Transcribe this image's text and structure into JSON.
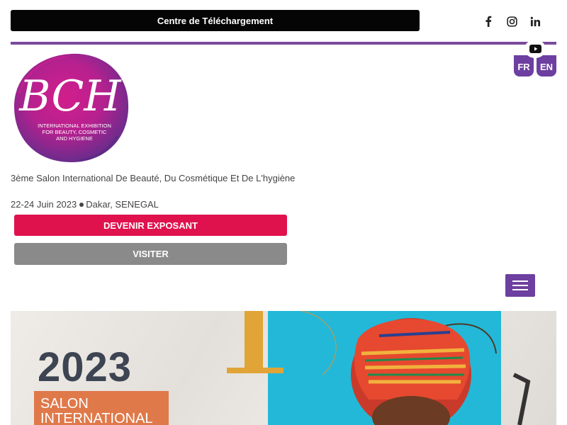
{
  "header": {
    "download_label": "Centre de Téléchargement",
    "social": [
      "facebook-icon",
      "instagram-icon",
      "linkedin-icon",
      "youtube-icon"
    ],
    "languages": [
      "FR",
      "EN"
    ]
  },
  "logo": {
    "letters": "BCH",
    "subtitle_lines": [
      "INTERNATIONAL EXHIBITION",
      "FOR BEAUTY, COSMETIC",
      "AND HYGIENE"
    ]
  },
  "event": {
    "tagline": "3ème Salon International De Beauté, Du Cosmétique Et De L'hygiène",
    "dates": "22-24 Juin 2023",
    "location": "Dakar, SENEGAL"
  },
  "buttons": {
    "exhibit": "DEVENIR EXPOSANT",
    "visit": "VISITER"
  },
  "hero": {
    "year": "2023",
    "headline": [
      "SALON",
      "INTERNATIONAL"
    ]
  },
  "colors": {
    "accent_purple": "#6d3fa0",
    "exhibit_red": "#e0124d",
    "visit_gray": "#8a8a8a",
    "hero_cyan": "#23b8d8",
    "hero_orange": "#e0794a"
  }
}
